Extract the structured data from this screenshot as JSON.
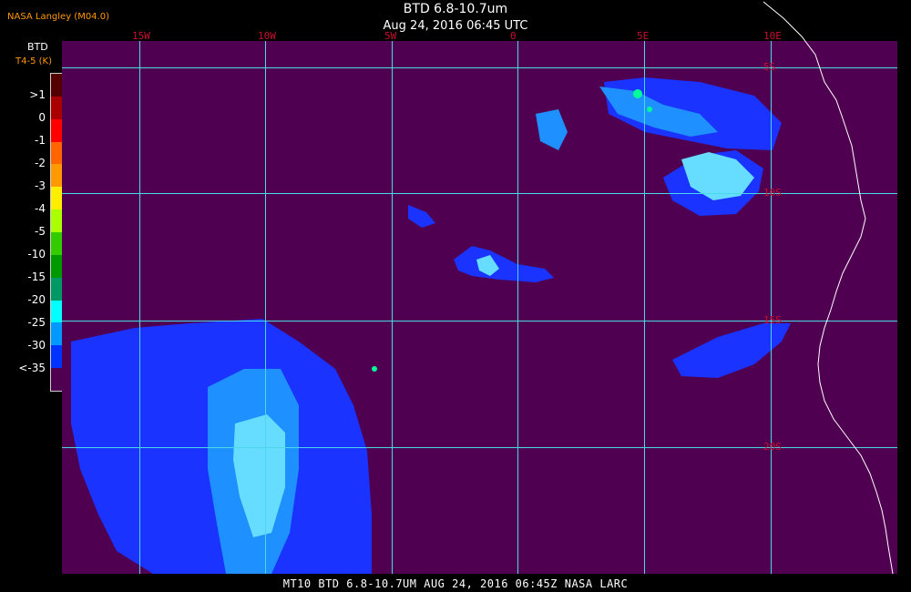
{
  "header": {
    "title": "BTD 6.8-10.7um",
    "timestamp": "Aug 24, 2016 06:45 UTC",
    "credit": "NASA Langley (M04.0)"
  },
  "legend": {
    "title": "BTD",
    "units": "T4-5 (K)",
    "ticks": [
      ">1",
      "0",
      "-1",
      "-2",
      "-3",
      "-4",
      "-5",
      "-10",
      "-15",
      "-20",
      "-25",
      "-30",
      "<-35"
    ],
    "colors": [
      "#550000",
      "#aa0000",
      "#ff0000",
      "#ff6600",
      "#ff9900",
      "#ffee00",
      "#aaff00",
      "#33cc00",
      "#009900",
      "#009966",
      "#00ffff",
      "#0099ff",
      "#0033ff",
      "#500050"
    ]
  },
  "map": {
    "background_color": "#500050",
    "grid_color": "#4ad8e6",
    "coast_color": "#ffffff",
    "cloud_colors": {
      "light": "#66ddff",
      "mid": "#1e90ff",
      "dark": "#1a33ff",
      "teal": "#00ff99"
    },
    "lon_labels": [
      "15W",
      "10W",
      "5W",
      "0",
      "5E",
      "10E"
    ],
    "lat_labels": [
      "5S",
      "10S",
      "15S",
      "20S"
    ]
  },
  "footer": {
    "text": "MT10  BTD 6.8-10.7UM   AUG 24, 2016 06:45Z   NASA LARC"
  }
}
